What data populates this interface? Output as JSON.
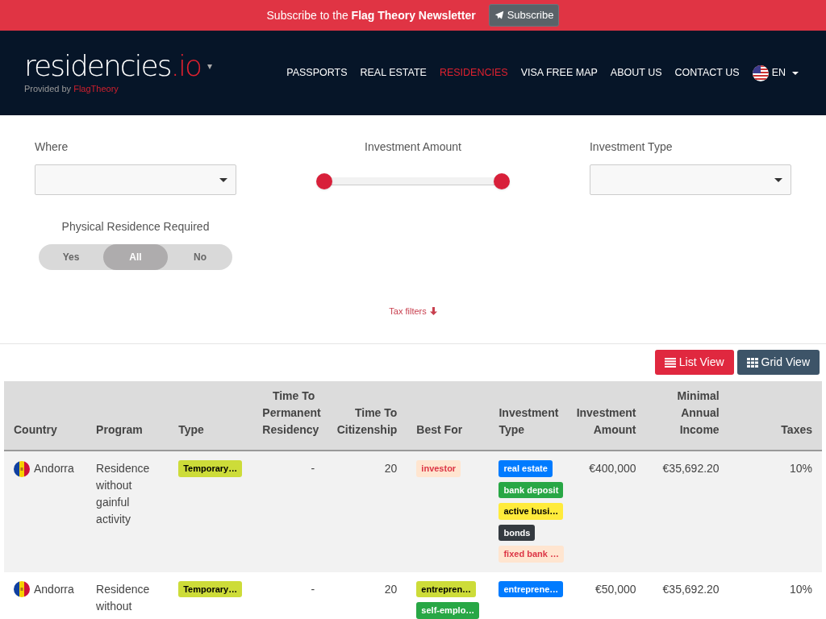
{
  "banner": {
    "text": "Subscribe to the **Flag Theory Newsletter**",
    "button": "Subscribe"
  },
  "header": {
    "logo_main": "residencies",
    "logo_tld": ".io",
    "logo_caret": "▾",
    "provided_by": "Provided by ",
    "provider": "FlagTheory",
    "nav": [
      {
        "label": "PASSPORTS",
        "selected": false
      },
      {
        "label": "REAL ESTATE",
        "selected": false
      },
      {
        "label": "RESIDENCIES",
        "selected": true
      },
      {
        "label": "VISA FREE MAP",
        "selected": false
      },
      {
        "label": "ABOUT US",
        "selected": false
      },
      {
        "label": "CONTACT US",
        "selected": false
      }
    ],
    "language": "EN"
  },
  "filters": {
    "where": {
      "label": "Where"
    },
    "investment_amount": {
      "label": "Investment Amount",
      "handles": [
        {
          "level": 0
        },
        {
          "level": 1
        }
      ]
    },
    "investment_type": {
      "label": "Investment Type"
    },
    "physical_residence": {
      "label": "Physical Residence Required",
      "options": [
        {
          "label": "Yes",
          "selected": false
        },
        {
          "label": "All",
          "selected": true
        },
        {
          "label": "No",
          "selected": false
        }
      ]
    },
    "tax_filters": "Tax filters"
  },
  "views": [
    {
      "label": "List View",
      "selected": true
    },
    {
      "label": "Grid View",
      "selected": false
    }
  ],
  "table": {
    "columns": [
      "Country",
      "Program",
      "Type",
      "Time To Permanent Residency",
      "Time To Citizenship",
      "Best For",
      "Investment Type",
      "Investment Amount",
      "Minimal Annual Income",
      "Taxes"
    ],
    "rows": [
      {
        "country": "Andorra",
        "program": "Residence without gainful activity",
        "type": [
          {
            "label": "Temporary…",
            "color": "#cddc39"
          }
        ],
        "time_to_pr": "-",
        "time_to_citizenship": "20",
        "best_for": [
          {
            "label": "investor",
            "color": "#ffe5d0"
          }
        ],
        "investment_type": [
          {
            "label": "real estate",
            "color": "#007bff"
          },
          {
            "label": "bank deposit",
            "color": "#28a745"
          },
          {
            "label": "active busi…",
            "color": "#ffeb3b"
          },
          {
            "label": "bonds",
            "color": "#343a40"
          },
          {
            "label": "fixed bank …",
            "color": "#ffe5d0"
          }
        ],
        "investment_amount": "€400,000",
        "minimal_income": "€35,692.20",
        "taxes": "10%"
      },
      {
        "country": "Andorra",
        "program": "Residence without",
        "type": [
          {
            "label": "Temporary…",
            "color": "#cddc39"
          }
        ],
        "time_to_pr": "-",
        "time_to_citizenship": "20",
        "best_for": [
          {
            "label": "entrepren…",
            "color": "#cddc39"
          },
          {
            "label": "self-emplo…",
            "color": "#28a745"
          }
        ],
        "investment_type": [
          {
            "label": "entreprene…",
            "color": "#007bff"
          }
        ],
        "investment_amount": "€50,000",
        "minimal_income": "€35,692.20",
        "taxes": "10%"
      }
    ]
  }
}
